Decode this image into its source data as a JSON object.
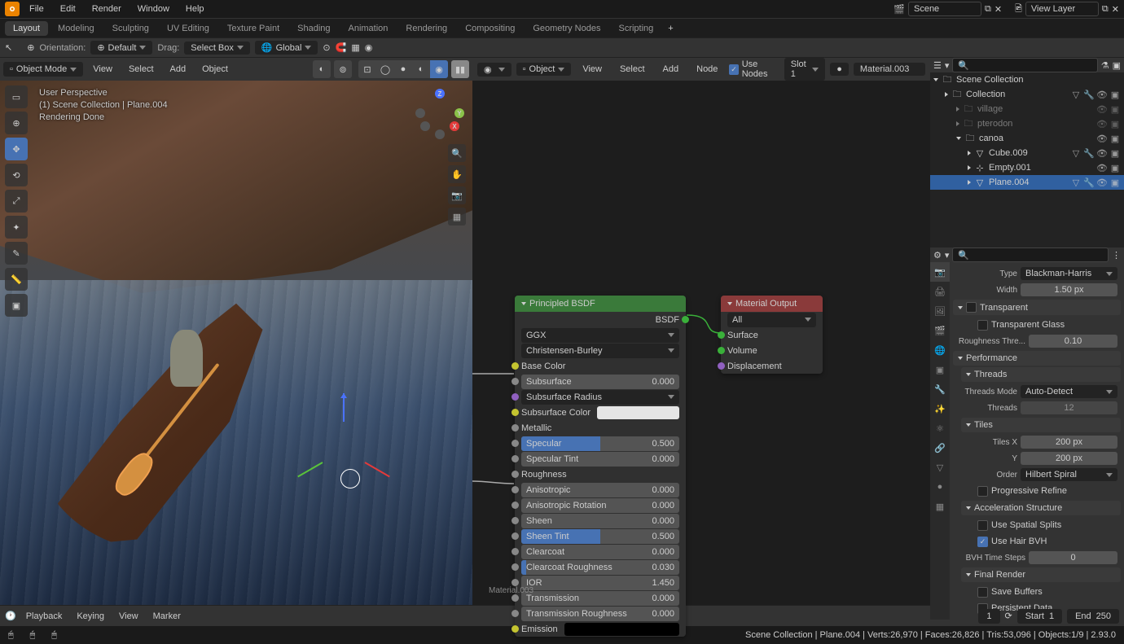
{
  "menus": [
    "File",
    "Edit",
    "Render",
    "Window",
    "Help"
  ],
  "workspaces": [
    "Layout",
    "Modeling",
    "Sculpting",
    "UV Editing",
    "Texture Paint",
    "Shading",
    "Animation",
    "Rendering",
    "Compositing",
    "Geometry Nodes",
    "Scripting"
  ],
  "active_workspace": "Layout",
  "scene_name": "Scene",
  "view_layer": "View Layer",
  "header3d": {
    "orientation": "Orientation:",
    "default": "Default",
    "drag": "Drag:",
    "select_box": "Select Box",
    "global": "Global"
  },
  "vp_menus": [
    "View",
    "Select",
    "Add",
    "Object"
  ],
  "mode": "Object Mode",
  "vp_overlay": {
    "line1": "User Perspective",
    "line2": "(1) Scene Collection | Plane.004",
    "line3": "Rendering Done"
  },
  "node_header": {
    "object": "Object",
    "menus": [
      "View",
      "Select",
      "Add",
      "Node"
    ],
    "use_nodes": "Use Nodes",
    "slot": "Slot 1",
    "material": "Material.003"
  },
  "node_bsdf": {
    "title": "Principled BSDF",
    "out": "BSDF",
    "dist": "GGX",
    "sss_method": "Christensen-Burley",
    "rows": [
      {
        "label": "Base Color",
        "type": "sock",
        "sock": "yellow"
      },
      {
        "label": "Subsurface",
        "type": "slider",
        "val": "0.000",
        "fill": 0
      },
      {
        "label": "Subsurface Radius",
        "type": "drop",
        "sock": "purple"
      },
      {
        "label": "Subsurface Color",
        "type": "swatch",
        "color": "#e5e5e5",
        "sock": "yellow"
      },
      {
        "label": "Metallic",
        "type": "sock",
        "sock": "gray"
      },
      {
        "label": "Specular",
        "type": "slider",
        "val": "0.500",
        "fill": 50
      },
      {
        "label": "Specular Tint",
        "type": "slider",
        "val": "0.000",
        "fill": 0
      },
      {
        "label": "Roughness",
        "type": "sock",
        "sock": "gray"
      },
      {
        "label": "Anisotropic",
        "type": "slider",
        "val": "0.000",
        "fill": 0
      },
      {
        "label": "Anisotropic Rotation",
        "type": "slider",
        "val": "0.000",
        "fill": 0
      },
      {
        "label": "Sheen",
        "type": "slider",
        "val": "0.000",
        "fill": 0
      },
      {
        "label": "Sheen Tint",
        "type": "slider",
        "val": "0.500",
        "fill": 50
      },
      {
        "label": "Clearcoat",
        "type": "slider",
        "val": "0.000",
        "fill": 0
      },
      {
        "label": "Clearcoat Roughness",
        "type": "slider",
        "val": "0.030",
        "fill": 3
      },
      {
        "label": "IOR",
        "type": "slider",
        "val": "1.450",
        "fill": 0,
        "center": true
      },
      {
        "label": "Transmission",
        "type": "slider",
        "val": "0.000",
        "fill": 0
      },
      {
        "label": "Transmission Roughness",
        "type": "slider",
        "val": "0.000",
        "fill": 0
      },
      {
        "label": "Emission",
        "type": "swatch",
        "color": "#000",
        "sock": "yellow"
      }
    ]
  },
  "node_output": {
    "title": "Material Output",
    "target": "All",
    "ins": [
      "Surface",
      "Volume",
      "Displacement"
    ]
  },
  "mat_label": "Material.003",
  "outliner": {
    "root": "Scene Collection",
    "items": [
      {
        "depth": 1,
        "name": "Collection",
        "type": "coll",
        "icons": "mods"
      },
      {
        "depth": 2,
        "name": "village",
        "type": "coll",
        "dim": true
      },
      {
        "depth": 2,
        "name": "pterodon",
        "type": "coll",
        "dim": true
      },
      {
        "depth": 2,
        "name": "canoa",
        "type": "coll",
        "open": true
      },
      {
        "depth": 3,
        "name": "Cube.009",
        "type": "mesh",
        "icons": "mods"
      },
      {
        "depth": 3,
        "name": "Empty.001",
        "type": "empty"
      },
      {
        "depth": 3,
        "name": "Plane.004",
        "type": "mesh",
        "sel": true,
        "icons": "mods2"
      }
    ]
  },
  "props": {
    "type_label": "Type",
    "type": "Blackman-Harris",
    "width_label": "Width",
    "width": "1.50 px",
    "panels": {
      "transparent": "Transparent",
      "transparent_glass": "Transparent Glass",
      "roughness_thre": "Roughness Thre...",
      "roughness_val": "0.10",
      "performance": "Performance",
      "threads": "Threads",
      "threads_mode_l": "Threads Mode",
      "threads_mode": "Auto-Detect",
      "threads_l": "Threads",
      "threads_v": "12",
      "tiles": "Tiles",
      "tiles_x_l": "Tiles X",
      "tiles_x": "200 px",
      "tiles_y_l": "Y",
      "tiles_y": "200 px",
      "order_l": "Order",
      "order": "Hilbert Spiral",
      "prog_refine": "Progressive Refine",
      "accel": "Acceleration Structure",
      "spatial": "Use Spatial Splits",
      "hair_bvh": "Use Hair BVH",
      "bvh_steps_l": "BVH Time Steps",
      "bvh_steps": "0",
      "final_render": "Final Render",
      "save_buffers": "Save Buffers",
      "persistent": "Persistent Data"
    }
  },
  "timeline": {
    "playback": "Playback",
    "keying": "Keying",
    "view": "View",
    "marker": "Marker",
    "frame": "1",
    "start_l": "Start",
    "start": "1",
    "end_l": "End",
    "end": "250"
  },
  "status": "Scene Collection | Plane.004 | Verts:26,970 | Faces:26,826 | Tris:53,096 | Objects:1/9 | 2.93.0"
}
